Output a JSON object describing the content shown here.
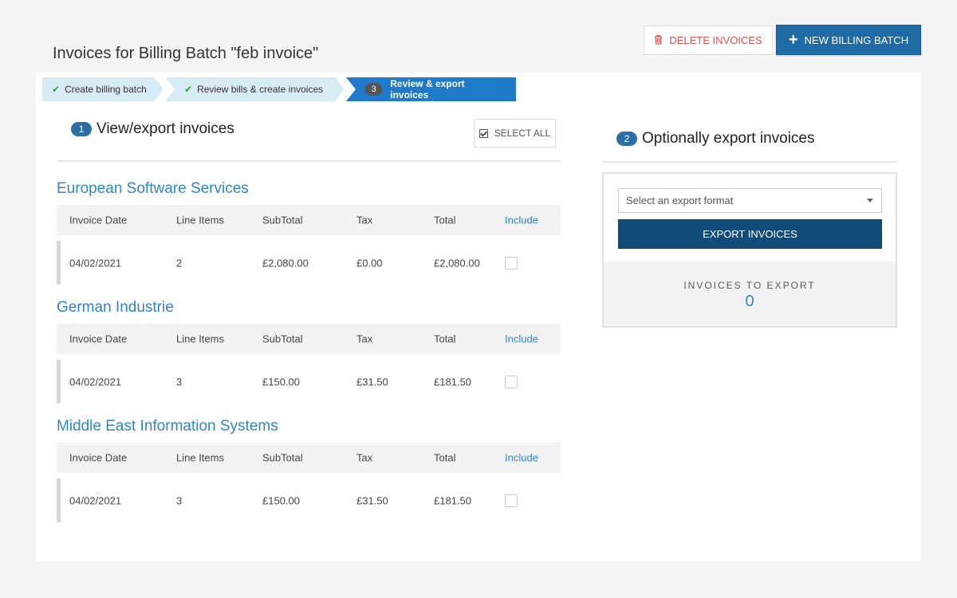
{
  "header": {
    "title": "Invoices for Billing Batch \"feb invoice\"",
    "delete_label": "DELETE INVOICES",
    "new_batch_label": "NEW BILLING BATCH"
  },
  "steps": [
    {
      "label": "Create billing batch",
      "state": "done"
    },
    {
      "label": "Review bills & create invoices",
      "state": "done"
    },
    {
      "number": "3",
      "label": "Review & export invoices",
      "state": "active"
    }
  ],
  "left": {
    "badge": "1",
    "title": "View/export invoices",
    "select_all_label": "SELECT ALL",
    "columns": [
      "Invoice Date",
      "Line Items",
      "SubTotal",
      "Tax",
      "Total",
      "Include"
    ],
    "companies": [
      {
        "name": "European Software Services",
        "rows": [
          {
            "date": "04/02/2021",
            "line_items": "2",
            "subtotal": "£2,080.00",
            "tax": "£0.00",
            "total": "£2,080.00",
            "include": false
          }
        ]
      },
      {
        "name": "German Industrie",
        "rows": [
          {
            "date": "04/02/2021",
            "line_items": "3",
            "subtotal": "£150.00",
            "tax": "£31.50",
            "total": "£181.50",
            "include": false
          }
        ]
      },
      {
        "name": "Middle East Information Systems",
        "rows": [
          {
            "date": "04/02/2021",
            "line_items": "3",
            "subtotal": "£150.00",
            "tax": "£31.50",
            "total": "£181.50",
            "include": false
          }
        ]
      }
    ]
  },
  "right": {
    "badge": "2",
    "title": "Optionally export invoices",
    "select_placeholder": "Select an export format",
    "export_label": "EXPORT INVOICES",
    "count_label": "INVOICES TO EXPORT",
    "count_value": "0"
  },
  "colors": {
    "primary": "#1f6ba5",
    "export_button": "#114b79",
    "link": "#2f87c4",
    "danger": "#d9534f",
    "step_active": "#1f7ac9",
    "step_done": "#d8ecf6"
  },
  "icons": {
    "delete": "trash-icon",
    "new": "plus-icon",
    "step_done": "check-icon",
    "select_all": "checkbox-checked-icon",
    "dropdown": "caret-down-icon"
  }
}
